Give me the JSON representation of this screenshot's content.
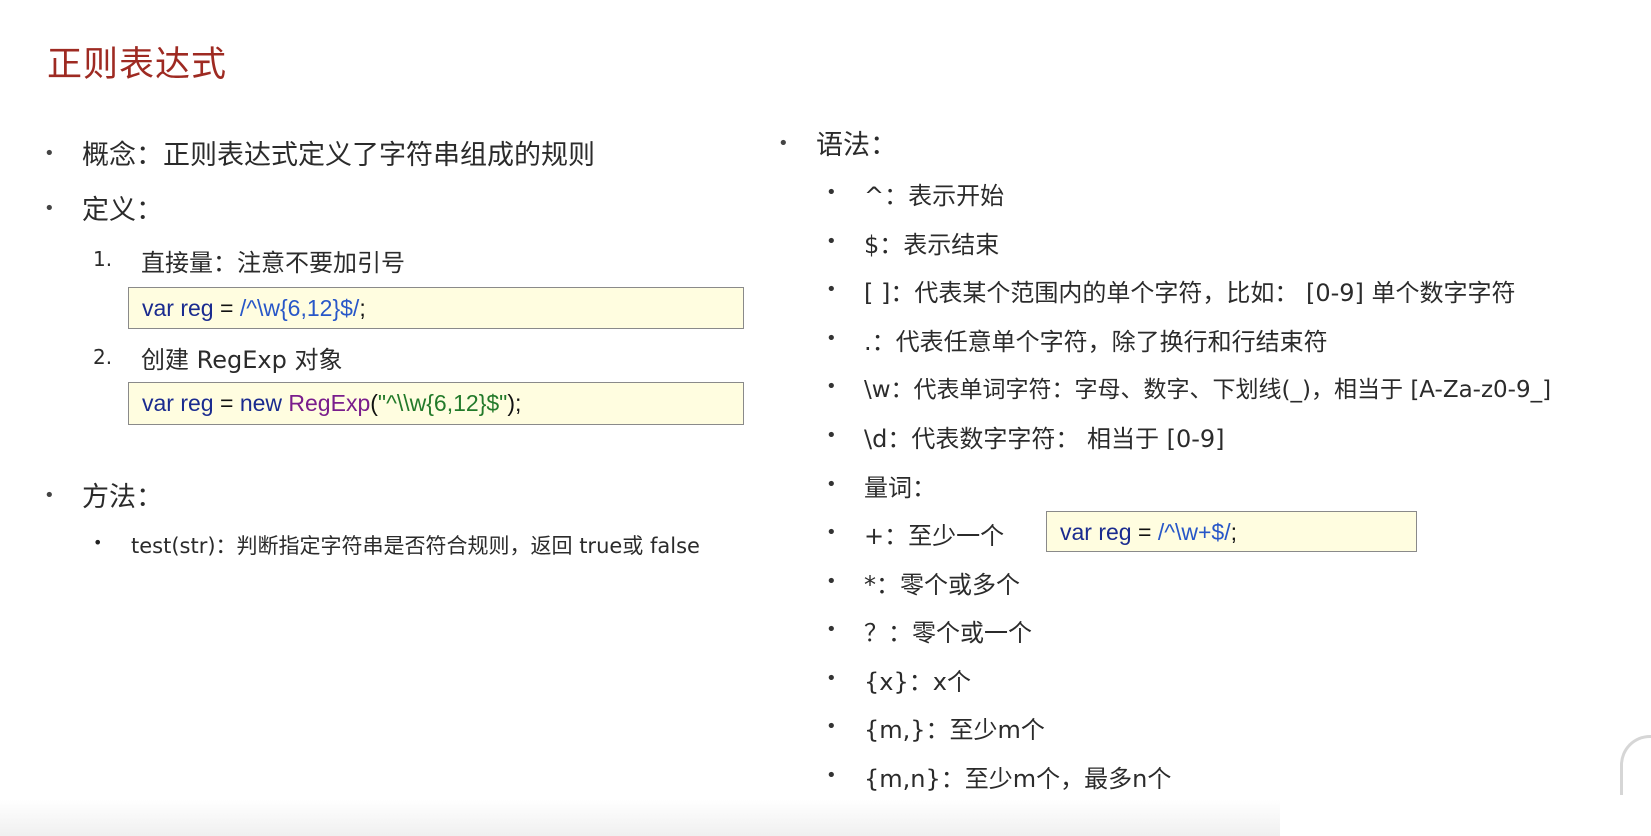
{
  "title": "正则表达式",
  "left": {
    "concept": "概念：正则表达式定义了字符串组成的规则",
    "definition_heading": "定义：",
    "def_items": [
      {
        "num": "1.",
        "label": "直接量：注意不要加引号"
      },
      {
        "num": "2.",
        "label": "创建 RegExp 对象"
      }
    ],
    "code1": {
      "kw": "var",
      "name": " reg",
      "eq": " = ",
      "regex": "/^\\w{6,12}$/",
      "end": ";"
    },
    "code2": {
      "kw": "var",
      "name": " reg",
      "eq": " = ",
      "new": "new ",
      "cls": "RegExp",
      "open": "(",
      "str": "\"^\\\\w{6,12}$\"",
      "close": ");"
    },
    "method_heading": "方法：",
    "method_item": "test(str)：判断指定字符串是否符合规则，返回 true或 false"
  },
  "right": {
    "syntax_heading": "语法：",
    "items": [
      "^：表示开始",
      "$：表示结束",
      "[ ]：代表某个范围内的单个字符，比如： [0-9] 单个数字字符",
      ".：代表任意单个字符，除了换行和行结束符",
      "\\w：代表单词字符：字母、数字、下划线(_)，相当于 [A-Za-z0-9_]",
      "\\d：代表数字字符： 相当于 [0-9]",
      "量词：",
      "+：至少一个",
      "*：零个或多个",
      "？：零个或一个",
      "{x}：x个",
      "{m,}：至少m个",
      "{m,n}：至少m个，最多n个"
    ],
    "code3": {
      "kw": "var",
      "name": " reg",
      "eq": " = ",
      "regex": "/^\\w+$/",
      "end": ";"
    }
  },
  "bullet_glyph": "•",
  "colors": {
    "title": "#9e2a22",
    "code_bg": "#fffde0",
    "keyword": "#1a2b8f",
    "regex": "#2857c8",
    "string": "#237a2a",
    "class": "#7a1d8c"
  }
}
